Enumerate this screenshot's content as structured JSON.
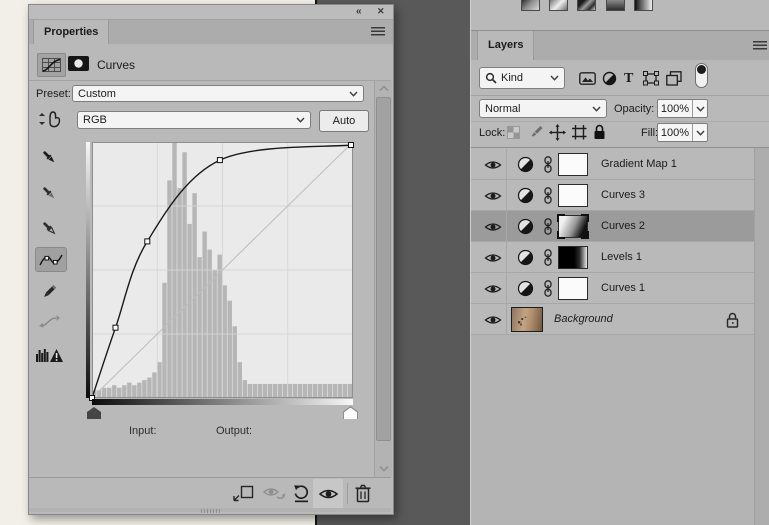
{
  "icons": {
    "collapse_glyph": "«",
    "close_glyph": "✕",
    "type_filter_glyph": "T"
  },
  "properties_panel": {
    "tab_label": "Properties",
    "adjustment_title": "Curves",
    "preset_label": "Preset:",
    "preset_value": "Custom",
    "channel_value": "RGB",
    "auto_label": "Auto",
    "input_label": "Input:",
    "output_label": "Output:",
    "chart_data": {
      "type": "line",
      "description": "RGB tone curve over luminosity histogram",
      "axis_max": 255,
      "grid_divisions": 4,
      "diagonal_reference": true,
      "curve_points": [
        [
          0,
          0
        ],
        [
          23,
          70
        ],
        [
          54,
          156
        ],
        [
          125,
          237
        ],
        [
          253,
          252
        ]
      ],
      "histogram": [
        0.03,
        0.03,
        0.04,
        0.04,
        0.05,
        0.04,
        0.05,
        0.06,
        0.05,
        0.06,
        0.07,
        0.08,
        0.1,
        0.14,
        0.45,
        0.85,
        1.0,
        0.82,
        0.96,
        0.68,
        0.8,
        0.55,
        0.65,
        0.58,
        0.5,
        0.56,
        0.44,
        0.38,
        0.28,
        0.14,
        0.07,
        0.055,
        0.055,
        0.055,
        0.055,
        0.055,
        0.055,
        0.055,
        0.055,
        0.055,
        0.055,
        0.055,
        0.055,
        0.055,
        0.055,
        0.055,
        0.055,
        0.055,
        0.055,
        0.055,
        0.055,
        0.055
      ],
      "colors": {
        "plot_bg": "#eaeaea",
        "histogram": "#b6b6b6",
        "grid": "#d6d6d6",
        "diagonal": "#bdbdbd",
        "curve": "#191919"
      }
    }
  },
  "layers_panel": {
    "tab_label": "Layers",
    "filter_kind_value": "Kind",
    "blend_mode_value": "Normal",
    "opacity_label": "Opacity:",
    "opacity_value": "100%",
    "lock_label": "Lock:",
    "fill_label": "Fill:",
    "fill_value": "100%",
    "layers": [
      {
        "name": "Gradient Map 1",
        "type": "adjustment",
        "mask": "white",
        "visible": true
      },
      {
        "name": "Curves 3",
        "type": "adjustment",
        "mask": "white",
        "visible": true
      },
      {
        "name": "Curves 2",
        "type": "adjustment",
        "mask": "gradient",
        "visible": true,
        "selected": true
      },
      {
        "name": "Levels 1",
        "type": "adjustment",
        "mask": "black-gradient",
        "visible": true
      },
      {
        "name": "Curves 1",
        "type": "adjustment",
        "mask": "white",
        "visible": true
      },
      {
        "name": "Background",
        "type": "image",
        "visible": true,
        "locked": true
      }
    ]
  },
  "colors": {
    "panel": "#b9b9b9",
    "pasteboard": "#595959",
    "canvas": "#f2efe8",
    "selected_row": "#9b9b9b"
  }
}
